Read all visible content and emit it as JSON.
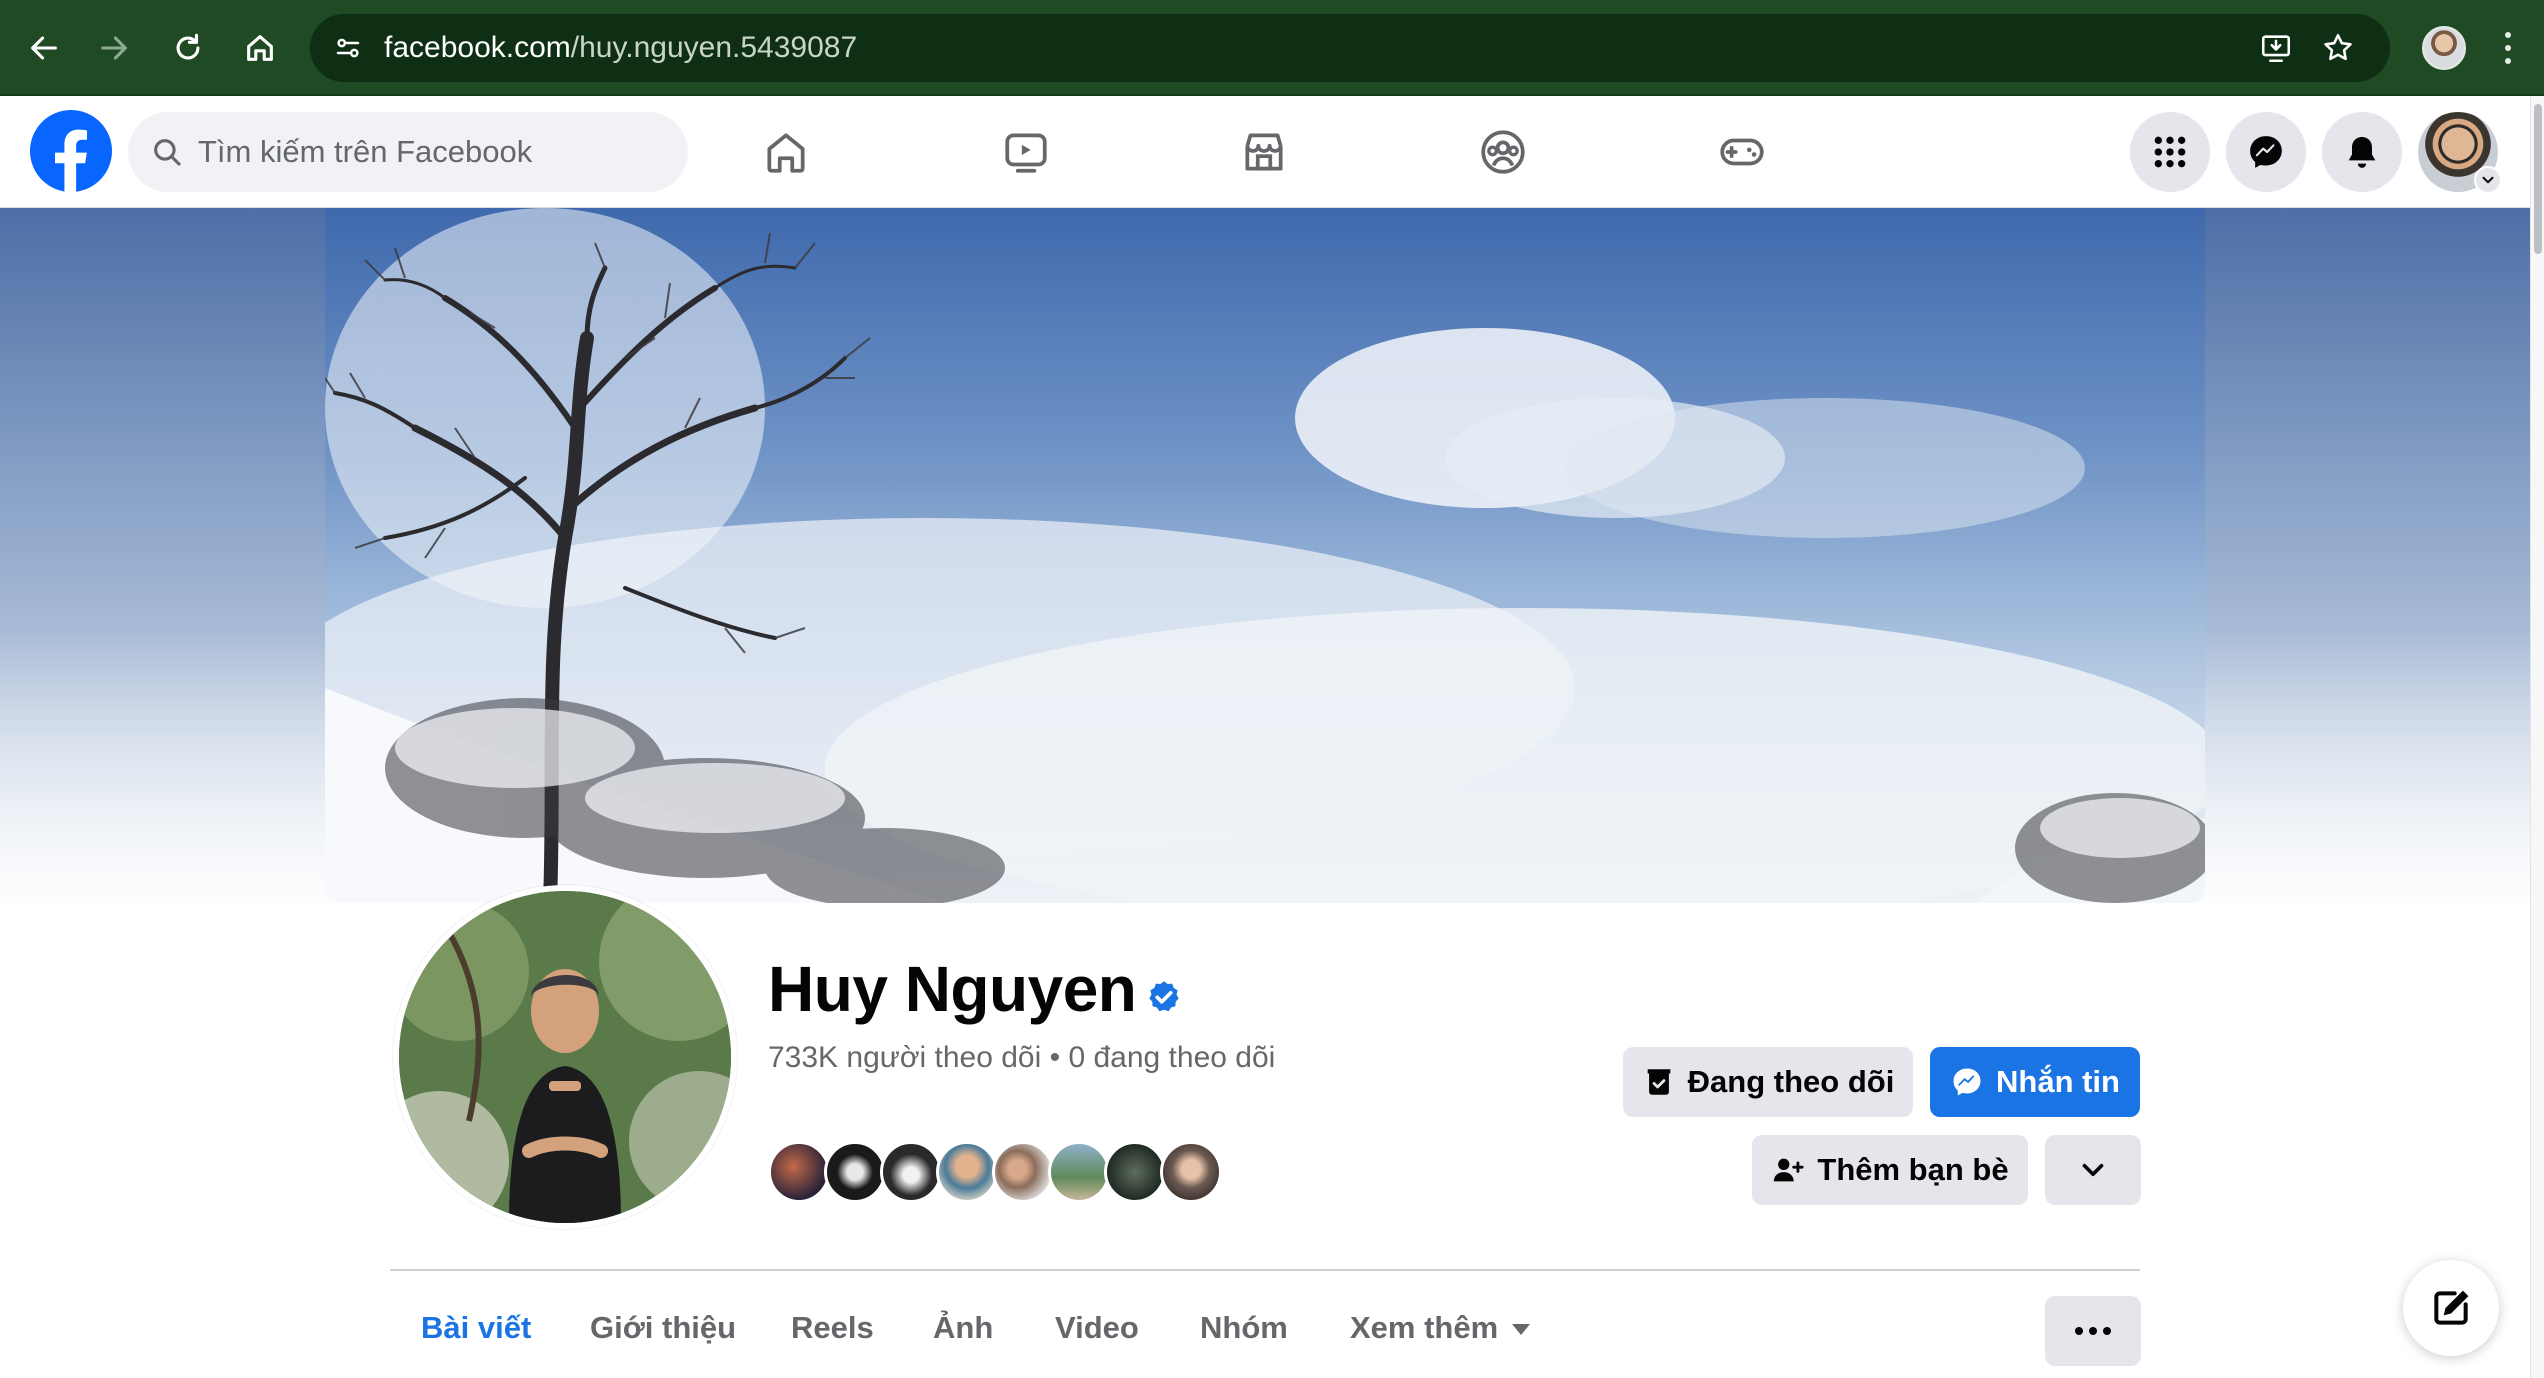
{
  "browser": {
    "url_host": "facebook.com",
    "url_path": "/huy.nguyen.5439087",
    "icons": [
      "back-icon",
      "forward-icon",
      "reload-icon",
      "home-icon",
      "site-settings-icon",
      "install-icon",
      "bookmark-star-icon",
      "profile-avatar",
      "menu-icon"
    ]
  },
  "facebook": {
    "search_placeholder": "Tìm kiếm trên Facebook",
    "nav_tabs": [
      "home-icon",
      "watch-icon",
      "marketplace-icon",
      "groups-icon",
      "gaming-icon"
    ],
    "right_icons": [
      "menu-grid-icon",
      "messenger-icon",
      "notifications-icon",
      "account-avatar"
    ],
    "brand_color": "#1b74e4"
  },
  "profile": {
    "name": "Huy Nguyen",
    "verified": true,
    "stats": "733K người theo dõi • 0 đang theo dõi",
    "buttons": {
      "following": "Đang theo dõi",
      "message": "Nhắn tin",
      "add_friend": "Thêm bạn bè"
    },
    "tabs": [
      "Bài viết",
      "Giới thiệu",
      "Reels",
      "Ảnh",
      "Video",
      "Nhóm",
      "Xem thêm"
    ],
    "active_tab": "Bài viết"
  }
}
